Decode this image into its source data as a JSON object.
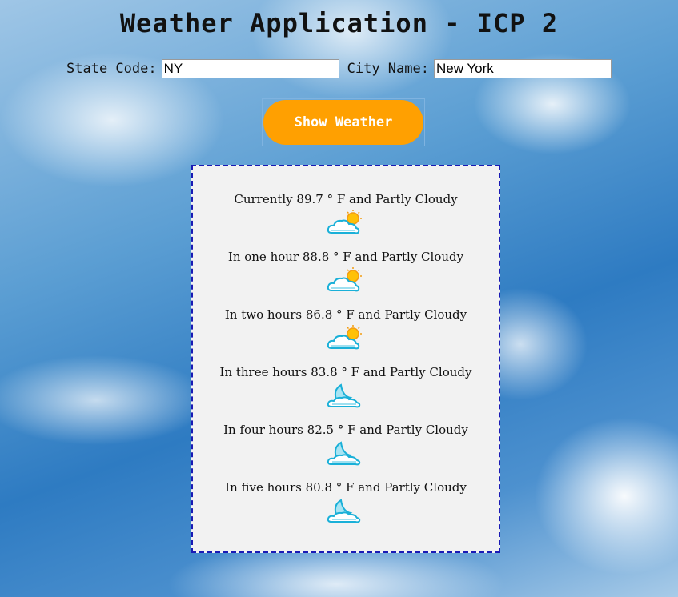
{
  "title": "Weather Application - ICP 2",
  "form": {
    "state_label": "State Code:",
    "state_value": "NY",
    "city_label": "City Name:",
    "city_value": "New York"
  },
  "button": {
    "label": "Show Weather"
  },
  "colors": {
    "button_bg": "#ffa001",
    "panel_border": "#1a1ab5",
    "panel_bg": "#f2f2f2"
  },
  "forecast": [
    {
      "text": "Currently 89.7 ° F and Partly Cloudy",
      "icon": "partly-cloudy-sun-icon"
    },
    {
      "text": "In one hour 88.8 ° F and Partly Cloudy",
      "icon": "partly-cloudy-sun-icon"
    },
    {
      "text": "In two hours 86.8 ° F and Partly Cloudy",
      "icon": "partly-cloudy-sun-icon"
    },
    {
      "text": "In three hours 83.8 ° F and Partly Cloudy",
      "icon": "partly-cloudy-moon-icon"
    },
    {
      "text": "In four hours 82.5 ° F and Partly Cloudy",
      "icon": "partly-cloudy-moon-icon"
    },
    {
      "text": "In five hours 80.8 ° F and Partly Cloudy",
      "icon": "partly-cloudy-moon-icon"
    }
  ]
}
